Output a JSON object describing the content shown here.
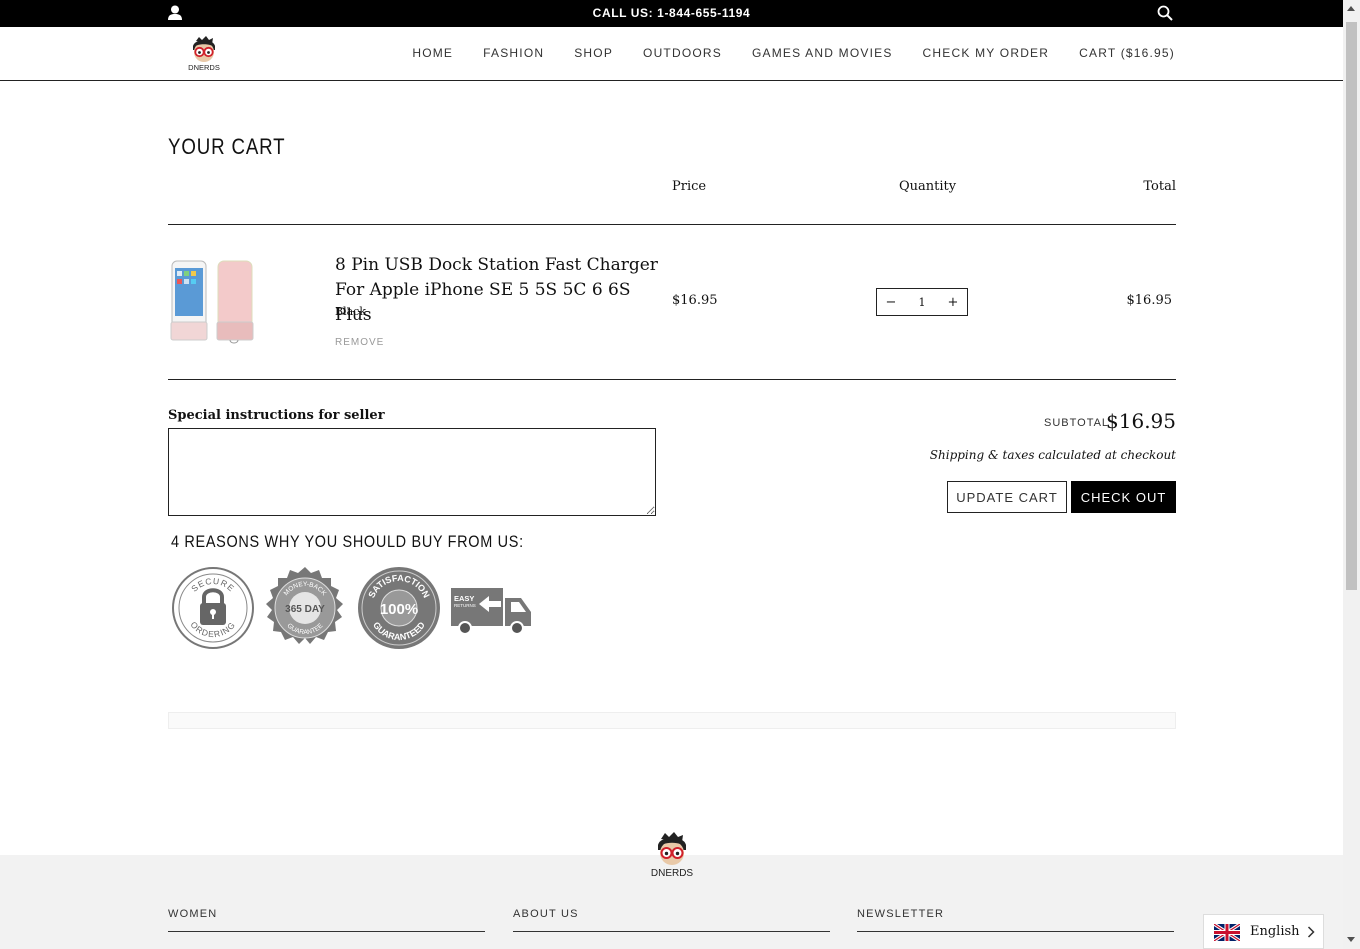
{
  "topbar": {
    "call": "CALL US: 1-844-655-1194"
  },
  "nav": {
    "items": [
      "HOME",
      "FASHION",
      "SHOP",
      "OUTDOORS",
      "GAMES AND MOVIES",
      "CHECK MY ORDER",
      "CART ($16.95)"
    ]
  },
  "logo_text": "DNERDS",
  "cart": {
    "title": "YOUR CART",
    "columns": {
      "price": "Price",
      "quantity": "Quantity",
      "total": "Total"
    },
    "item": {
      "title": "8 Pin USB Dock Station Fast Charger For Apple iPhone SE 5 5S 5C 6 6S Plus",
      "variant": "Black",
      "remove": "REMOVE",
      "price": "$16.95",
      "quantity": "1",
      "total": "$16.95",
      "minus": "−",
      "plus": "+"
    },
    "instructions_label": "Special instructions for seller",
    "subtotal_label": "SUBTOTAL",
    "subtotal": "$16.95",
    "shipping_note": "Shipping & taxes calculated at checkout",
    "update_button": "UPDATE CART",
    "checkout_button": "CHECK OUT"
  },
  "reasons": {
    "title": "4 REASONS WHY YOU SHOULD BUY FROM US:",
    "badges": [
      "SECURE ORDERING",
      "365 DAY MONEY-BACK GUARANTEE",
      "SATISFACTION 100% GUARANTEED",
      "EASY RETURNS"
    ]
  },
  "footer": {
    "logo_text": "DNERDS",
    "columns": [
      "WOMEN",
      "ABOUT US",
      "NEWSLETTER"
    ]
  },
  "language": {
    "label": "English"
  }
}
